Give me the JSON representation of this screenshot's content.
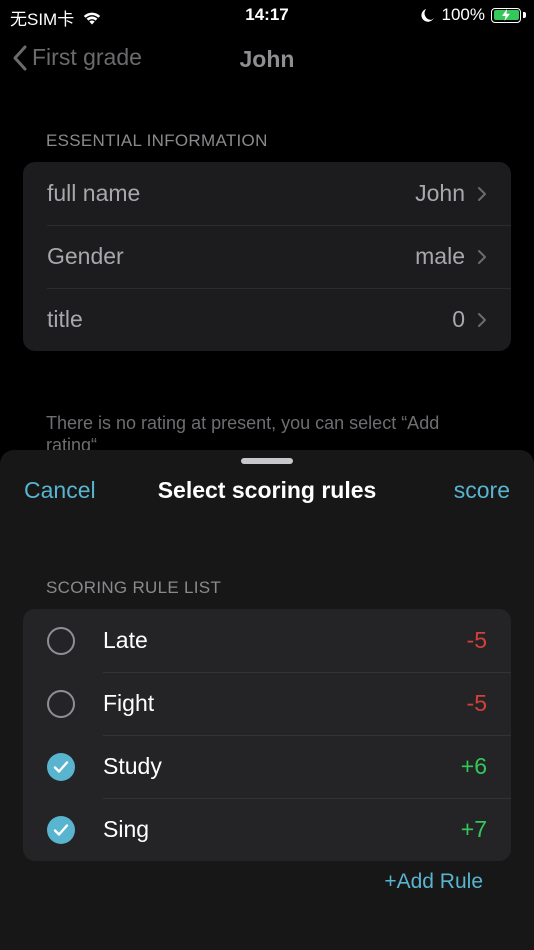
{
  "status_bar": {
    "carrier": "无SIM卡",
    "time": "14:17",
    "battery": "100%"
  },
  "nav": {
    "back_label": "First grade",
    "title": "John"
  },
  "essential": {
    "header": "ESSENTIAL INFORMATION",
    "rows": [
      {
        "label": "full name",
        "value": "John"
      },
      {
        "label": "Gender",
        "value": "male"
      },
      {
        "label": "title",
        "value": "0"
      }
    ]
  },
  "empty_note": "There is no rating at present, you can select “Add rating“",
  "sheet": {
    "cancel_label": "Cancel",
    "title": "Select scoring rules",
    "score_label": "score",
    "list_header": "SCORING RULE LIST",
    "rules": [
      {
        "name": "Late",
        "score": "-5",
        "checked": false
      },
      {
        "name": "Fight",
        "score": "-5",
        "checked": false
      },
      {
        "name": "Study",
        "score": "+6",
        "checked": true
      },
      {
        "name": "Sing",
        "score": "+7",
        "checked": true
      }
    ],
    "add_rule_label": "+Add Rule"
  },
  "colors": {
    "accent": "#58b4cf",
    "negative": "#d2403a",
    "positive": "#34c759",
    "battery": "#34c759"
  },
  "icons": {
    "back": "chevron-left-icon",
    "row_chevron": "chevron-right-icon",
    "wifi": "wifi-icon",
    "moon": "moon-icon",
    "battery": "battery-charging-icon",
    "check": "checkmark-icon"
  }
}
